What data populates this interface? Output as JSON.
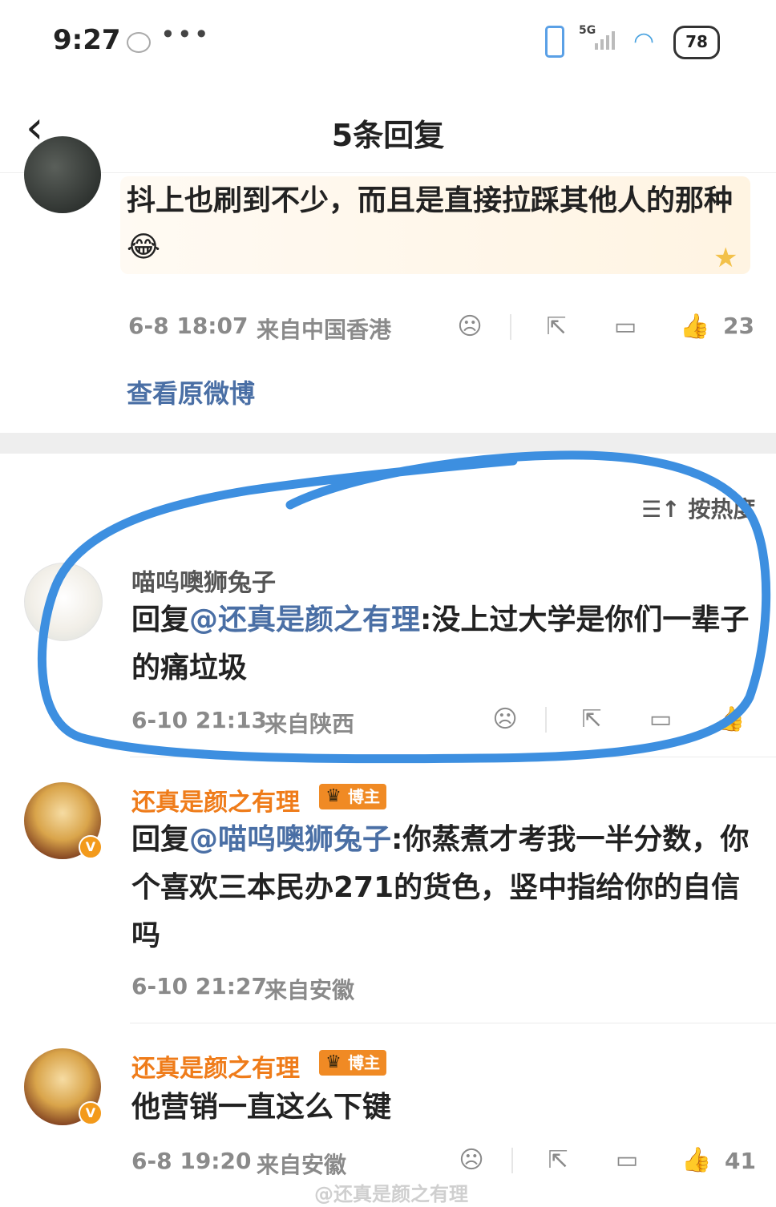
{
  "status_bar": {
    "time": "9:27",
    "dots": "•••",
    "network": "5G",
    "battery": "78",
    "icons": [
      "app-icon",
      "vibrate-icon",
      "signal-icon",
      "wifi-icon",
      "battery-icon"
    ]
  },
  "header": {
    "title": "5条回复",
    "back_icon": "chevron-left-icon"
  },
  "original_post": {
    "text": "抖上也刷到不少，而且是直接拉踩其他人的那种😂",
    "time": "6-8 18:07",
    "location": "来自中国香港",
    "like_count": "23",
    "view_original": "查看原微博"
  },
  "sort": {
    "label": "按热度",
    "icon": "sort-icon"
  },
  "comments": [
    {
      "name": "喵呜噢狮兔子",
      "reply_prefix": "回复",
      "mention": "@还真是颜之有理",
      "text": ":没上过大学是你们一辈子的痛垃圾",
      "time": "6-10 21:13",
      "location": "来自陕西"
    },
    {
      "name": "还真是颜之有理",
      "badge": "博主",
      "badge_level": "III",
      "reply_prefix": "回复",
      "mention": "@喵呜噢狮兔子",
      "text": ":你蒸煮才考我一半分数，你个喜欢三本民办271的货色，竖中指给你的自信吗",
      "time": "6-10 21:27",
      "location": "来自安徽"
    },
    {
      "name": "还真是颜之有理",
      "badge": "博主",
      "badge_level": "III",
      "text": "他营销一直这么下键",
      "time": "6-8 19:20",
      "location": "来自安徽",
      "like_count": "41"
    }
  ],
  "watermark": "@还真是颜之有理",
  "colors": {
    "link": "#4a6fa5",
    "blogger_name": "#ef7c1a",
    "badge": "#f08a24",
    "marker": "#3d8fe0"
  }
}
